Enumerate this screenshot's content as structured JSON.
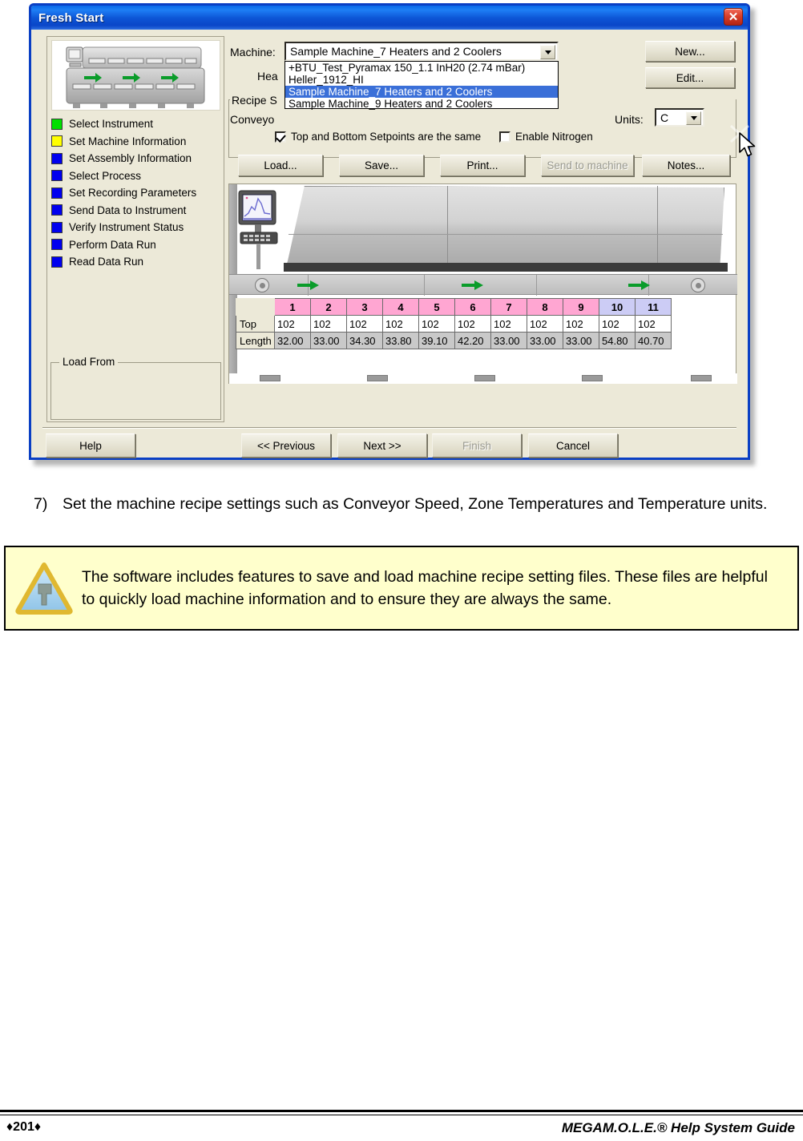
{
  "window": {
    "title": "Fresh Start",
    "close_icon": "close-icon"
  },
  "left_panel": {
    "steps": [
      {
        "label": "Select Instrument",
        "color": "#00e000"
      },
      {
        "label": "Set Machine Information",
        "color": "#ffff00"
      },
      {
        "label": "Set Assembly Information",
        "color": "#0000ee"
      },
      {
        "label": "Select Process",
        "color": "#0000ee"
      },
      {
        "label": "Set Recording Parameters",
        "color": "#0000ee"
      },
      {
        "label": "Send Data to Instrument",
        "color": "#0000ee"
      },
      {
        "label": "Verify Instrument Status",
        "color": "#0000ee"
      },
      {
        "label": "Perform Data Run",
        "color": "#0000ee"
      },
      {
        "label": "Read Data Run",
        "color": "#0000ee"
      }
    ],
    "load_from_legend": "Load From"
  },
  "right_panel": {
    "machine_label": "Machine:",
    "machine_value": "Sample Machine_7 Heaters and 2 Coolers",
    "heaters_label_partial": "Hea",
    "recipe_legend_partial": "Recipe S",
    "conveyor_label_partial": "Conveyo",
    "units_label": "Units:",
    "units_value": "C",
    "new_label": "New...",
    "edit_label": "Edit...",
    "dropdown_options": [
      "+BTU_Test_Pyramax 150_1.1 InH20 (2.74 mBar)",
      "Heller_1912_HI",
      "Sample Machine_7 Heaters and 2 Coolers",
      "Sample Machine_9 Heaters and 2 Coolers"
    ],
    "dropdown_selected_index": 2,
    "checkboxes": [
      {
        "label": "Top and Bottom Setpoints are the same",
        "checked": true
      },
      {
        "label": "Enable Nitrogen",
        "checked": false
      }
    ],
    "recipe_buttons": [
      {
        "label": "Load...",
        "disabled": false
      },
      {
        "label": "Save...",
        "disabled": false
      },
      {
        "label": "Print...",
        "disabled": false
      },
      {
        "label": "Send to machine",
        "disabled": true
      },
      {
        "label": "Notes...",
        "disabled": false
      }
    ]
  },
  "zone_table": {
    "row_headers": [
      "Top",
      "Length"
    ],
    "zones": [
      "1",
      "2",
      "3",
      "4",
      "5",
      "6",
      "7",
      "8",
      "9",
      "10",
      "11"
    ],
    "zone_types": [
      "heater",
      "heater",
      "heater",
      "heater",
      "heater",
      "heater",
      "heater",
      "heater",
      "heater",
      "cooler",
      "cooler"
    ],
    "top": [
      "102",
      "102",
      "102",
      "102",
      "102",
      "102",
      "102",
      "102",
      "102",
      "102",
      "102"
    ],
    "length": [
      "32.00",
      "33.00",
      "34.30",
      "33.80",
      "39.10",
      "42.20",
      "33.00",
      "33.00",
      "33.00",
      "54.80",
      "40.70"
    ],
    "heater_color": "#ffa6d2",
    "cooler_color": "#ccccf5"
  },
  "bottom_buttons": [
    {
      "label": "Help",
      "disabled": false
    },
    {
      "label": "<< Previous",
      "disabled": false
    },
    {
      "label": "Next >>",
      "disabled": false
    },
    {
      "label": "Finish",
      "disabled": true
    },
    {
      "label": "Cancel",
      "disabled": false
    }
  ],
  "page": {
    "step_number": "7)",
    "step_text": "Set the machine recipe settings such as Conveyor Speed, Zone Temperatures and Temperature units.",
    "note_text": "The software includes features to save and load machine recipe setting files. These files are helpful to quickly load machine information and to ensure they are always the same.",
    "note_icon": "tip-triangle-icon",
    "note_bg": "#ffffcc"
  },
  "footer": {
    "page_number": "♦201♦",
    "guide_title": "MEGAM.O.L.E.® Help System Guide"
  }
}
